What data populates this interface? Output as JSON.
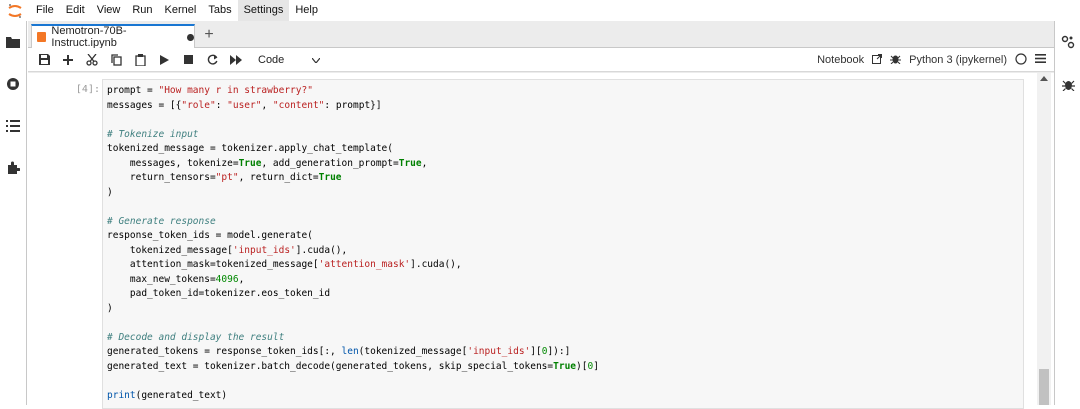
{
  "menubar": {
    "items": [
      "File",
      "Edit",
      "View",
      "Run",
      "Kernel",
      "Tabs",
      "Settings",
      "Help"
    ],
    "active": "Settings"
  },
  "tab": {
    "title": "Nemotron-70B-Instruct.ipynb",
    "add_label": "+"
  },
  "toolbar": {
    "cell_type": "Code",
    "notebook_label": "Notebook",
    "kernel_label": "Python 3 (ipykernel)"
  },
  "cell": {
    "prompt": "[4]:",
    "code_lines": [
      "prompt = \"How many r in strawberry?\"",
      "messages = [{\"role\": \"user\", \"content\": prompt}]",
      "",
      "# Tokenize input",
      "tokenized_message = tokenizer.apply_chat_template(",
      "    messages, tokenize=True, add_generation_prompt=True,",
      "    return_tensors=\"pt\", return_dict=True",
      ")",
      "",
      "# Generate response",
      "response_token_ids = model.generate(",
      "    tokenized_message['input_ids'].cuda(),",
      "    attention_mask=tokenized_message['attention_mask'].cuda(),",
      "    max_new_tokens=4096,",
      "    pad_token_id=tokenizer.eos_token_id",
      ")",
      "",
      "# Decode and display the result",
      "generated_tokens = response_token_ids[:, len(tokenized_message['input_ids'][0]):]",
      "generated_text = tokenizer.batch_decode(generated_tokens, skip_special_tokens=True)[0]",
      "",
      "print(generated_text)"
    ]
  },
  "colors": {
    "accent": "#1976d2",
    "notebook_icon": "#f37726",
    "keyword": "#008000",
    "string": "#ba2121",
    "comment": "#408080"
  }
}
